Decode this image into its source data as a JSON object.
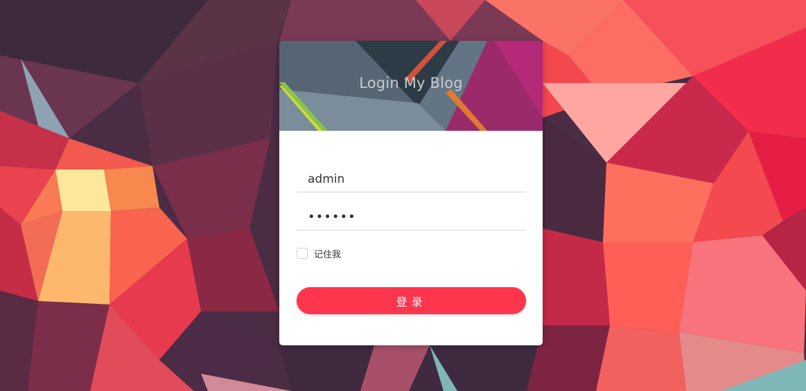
{
  "login_card": {
    "title": "Login My Blog",
    "username_value": "admin",
    "password_value": "••••••",
    "remember_label": "记住我",
    "remember_checked": false,
    "submit_label": "登录"
  },
  "colors": {
    "accent": "#fd354d",
    "card_background": "#ffffff",
    "title_text": "#c9ccd1",
    "divider": "#d7d7d7"
  }
}
